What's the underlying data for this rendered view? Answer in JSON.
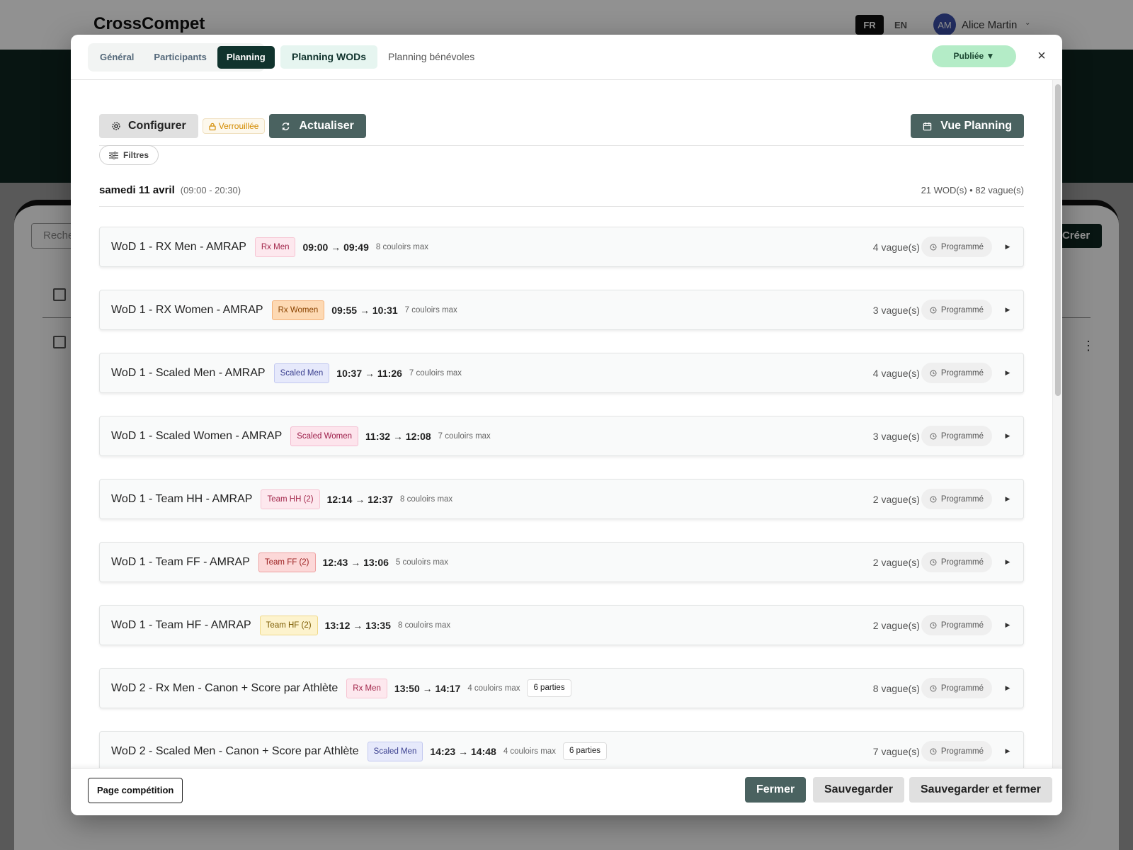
{
  "background": {
    "logo": "CrossCompet",
    "lang_fr": "FR",
    "lang_en": "EN",
    "avatar_initials": "AM",
    "user_name": "Alice Martin",
    "search_placeholder": "Reche",
    "create_label": "Créer"
  },
  "header": {
    "tabs": [
      {
        "label": "Général",
        "active": false
      },
      {
        "label": "Participants",
        "active": false
      },
      {
        "label": "Planning",
        "active": true
      }
    ],
    "subtabs": [
      {
        "label": "Planning WODs",
        "active": true
      },
      {
        "label": "Planning bénévoles",
        "active": false
      }
    ],
    "status_label": "Publiée ▼",
    "close_label": "×"
  },
  "toolbar": {
    "configure_label": "Configurer",
    "locked_label": "Verrouillée",
    "refresh_label": "Actualiser",
    "view_label": "Vue Planning",
    "filters_label": "Filtres"
  },
  "day": {
    "title": "samedi 11 avril",
    "hours": "(09:00 - 20:30)",
    "stats": "21 WOD(s) • 82 vague(s)"
  },
  "colors": {
    "dark_green": "#10332d",
    "slate_button": "#4a6260",
    "published_green": "#b4ecc7",
    "locked_amber": "#d38b00"
  },
  "wods": [
    {
      "name": "WoD 1 - RX Men - AMRAP",
      "category": "Rx Men",
      "cat_style": "pink",
      "time": "09:00 → 09:49",
      "lanes": "8 couloirs max",
      "parts": "",
      "waves": "4 vague(s)",
      "status": "Programmé"
    },
    {
      "name": "WoD 1 - RX Women - AMRAP",
      "category": "Rx Women",
      "cat_style": "orange",
      "time": "09:55 → 10:31",
      "lanes": "7 couloirs max",
      "parts": "",
      "waves": "3 vague(s)",
      "status": "Programmé"
    },
    {
      "name": "WoD 1 - Scaled Men - AMRAP",
      "category": "Scaled Men",
      "cat_style": "blue",
      "time": "10:37 → 11:26",
      "lanes": "7 couloirs max",
      "parts": "",
      "waves": "4 vague(s)",
      "status": "Programmé"
    },
    {
      "name": "WoD 1 - Scaled Women - AMRAP",
      "category": "Scaled Women",
      "cat_style": "rose",
      "time": "11:32 → 12:08",
      "lanes": "7 couloirs max",
      "parts": "",
      "waves": "3 vague(s)",
      "status": "Programmé"
    },
    {
      "name": "WoD 1 - Team HH - AMRAP",
      "category": "Team HH (2)",
      "cat_style": "pink",
      "time": "12:14 → 12:37",
      "lanes": "8 couloirs max",
      "parts": "",
      "waves": "2 vague(s)",
      "status": "Programmé"
    },
    {
      "name": "WoD 1 - Team FF - AMRAP",
      "category": "Team FF (2)",
      "cat_style": "red",
      "time": "12:43 → 13:06",
      "lanes": "5 couloirs max",
      "parts": "",
      "waves": "2 vague(s)",
      "status": "Programmé"
    },
    {
      "name": "WoD 1 - Team HF - AMRAP",
      "category": "Team HF (2)",
      "cat_style": "yellow",
      "time": "13:12 → 13:35",
      "lanes": "8 couloirs max",
      "parts": "",
      "waves": "2 vague(s)",
      "status": "Programmé"
    },
    {
      "name": "WoD 2 - Rx Men - Canon + Score par Athlète",
      "category": "Rx Men",
      "cat_style": "pink",
      "time": "13:50 → 14:17",
      "lanes": "4 couloirs max",
      "parts": "6 parties",
      "waves": "8 vague(s)",
      "status": "Programmé"
    },
    {
      "name": "WoD 2 - Scaled Men - Canon + Score par Athlète",
      "category": "Scaled Men",
      "cat_style": "blue",
      "time": "14:23 → 14:48",
      "lanes": "4 couloirs max",
      "parts": "6 parties",
      "waves": "7 vague(s)",
      "status": "Programmé"
    }
  ],
  "cat_styles": {
    "pink": {
      "bg": "#fde8ee",
      "border": "#f6c4d2",
      "color": "#a3284c"
    },
    "orange": {
      "bg": "#fdd9b3",
      "border": "#f3b27a",
      "color": "#8a4300"
    },
    "blue": {
      "bg": "#e6e9fb",
      "border": "#c3c9f0",
      "color": "#3a3f8f"
    },
    "rose": {
      "bg": "#fde4ec",
      "border": "#f3bcd0",
      "color": "#9c1c48"
    },
    "red": {
      "bg": "#fcd8d8",
      "border": "#ee9f9f",
      "color": "#9a1d1d"
    },
    "yellow": {
      "bg": "#fdf3cd",
      "border": "#efd98a",
      "color": "#7a5a00"
    }
  },
  "footer": {
    "page_label": "Page compétition",
    "close_label": "Fermer",
    "save_label": "Sauvegarder",
    "save_close_label": "Sauvegarder et fermer"
  }
}
